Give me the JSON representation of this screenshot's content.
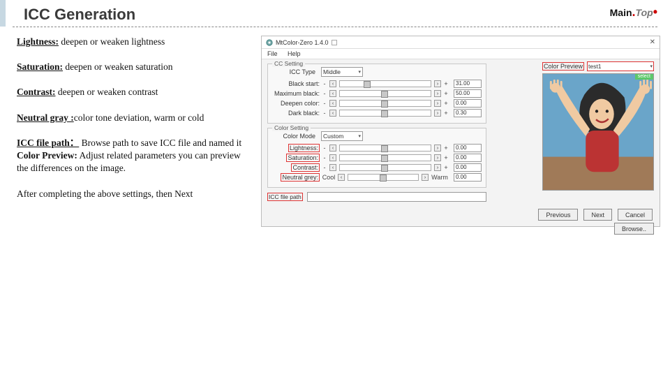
{
  "slide": {
    "title": "ICC Generation"
  },
  "logo": {
    "main": "Main",
    "top": "Top"
  },
  "explain": {
    "p1_b": "Lightness:",
    "p1": " deepen or weaken lightness",
    "p2_b": "Saturation:",
    "p2": " deepen or weaken saturation",
    "p3_b": "Contrast:",
    "p3": " deepen or weaken contrast",
    "p4_b": "Neutral gray :",
    "p4": "color tone deviation, warm or cold",
    "p5_b": "ICC file path：",
    "p5": "Browse path  to save  ICC file and named it",
    "p6_b": "Color Preview:",
    "p6": " Adjust related parameters you can preview the differences on the image.",
    "p7": "After completing the above settings, then Next"
  },
  "app": {
    "title": "MtColor-Zero 1.4.0",
    "menu": {
      "file": "File",
      "help": "Help"
    },
    "close": "✕",
    "cc_group": "CC Setting",
    "color_group": "Color Setting",
    "icctype_label": "ICC Type",
    "icctype_value": "Middle",
    "preview_label": "Color Preview",
    "preview_value": "test1",
    "select_badge": "select",
    "rows_cc": [
      {
        "label": "Black start:",
        "value": "31.00",
        "pos": 31
      },
      {
        "label": "Maximum black:",
        "value": "50.00",
        "pos": 50
      },
      {
        "label": "Deepen color:",
        "value": "0.00",
        "pos": 50
      },
      {
        "label": "Dark black:",
        "value": "0.30",
        "pos": 50
      }
    ],
    "color_mode_label": "Color Mode",
    "color_mode_value": "Custom",
    "rows_color": [
      {
        "label": "Lightness:",
        "value": "0.00",
        "pos": 50,
        "boxed": true,
        "left": "-",
        "right": "+"
      },
      {
        "label": "Saturation:",
        "value": "0.00",
        "pos": 50,
        "boxed": true,
        "left": "-",
        "right": "+"
      },
      {
        "label": "Contrast:",
        "value": "0.00",
        "pos": 50,
        "boxed": true,
        "left": "-",
        "right": "+"
      },
      {
        "label": "Neutral grey:",
        "value": "0.00",
        "pos": 50,
        "boxed": true,
        "left": "Cool",
        "right": "Warm",
        "narrow": true
      }
    ],
    "icc_path_label": "ICC file path",
    "browse": "Browse..",
    "prev": "Previous",
    "next": "Next",
    "cancel": "Cancel"
  }
}
